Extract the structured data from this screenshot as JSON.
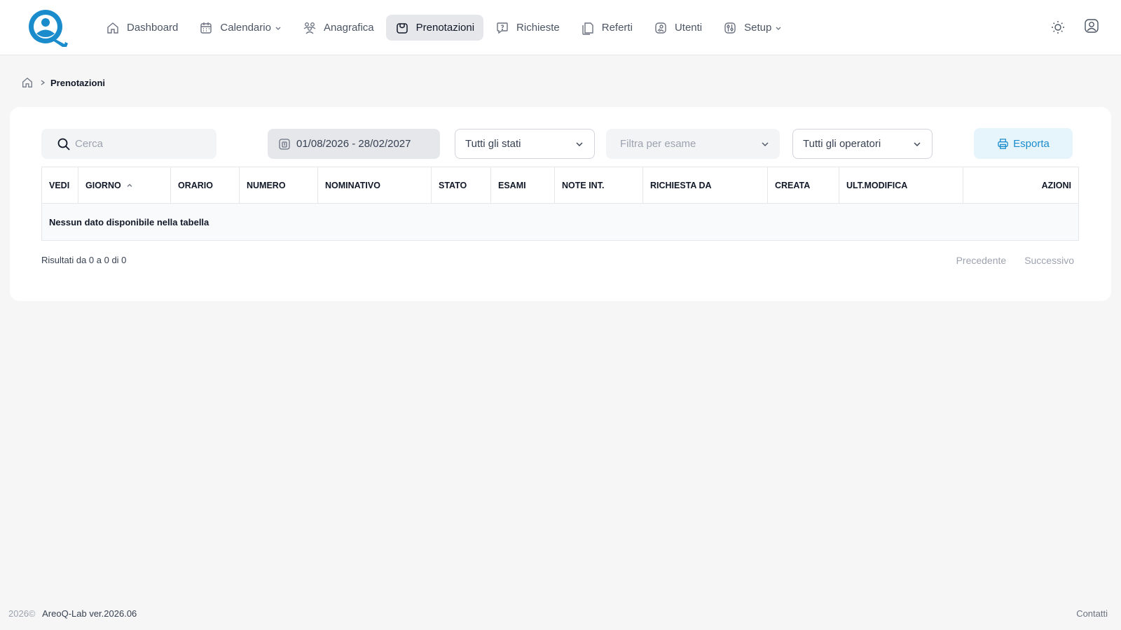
{
  "brand": {
    "logo_icon": "q-logo-icon",
    "accent": "#1a8ccc"
  },
  "nav": {
    "items": [
      {
        "label": "Dashboard",
        "icon": "home-icon",
        "has_dropdown": false,
        "active": false
      },
      {
        "label": "Calendario",
        "icon": "calendar-icon",
        "has_dropdown": true,
        "active": false
      },
      {
        "label": "Anagrafica",
        "icon": "people-icon",
        "has_dropdown": false,
        "active": false
      },
      {
        "label": "Prenotazioni",
        "icon": "booking-icon",
        "has_dropdown": false,
        "active": true
      },
      {
        "label": "Richieste",
        "icon": "question-icon",
        "has_dropdown": false,
        "active": false
      },
      {
        "label": "Referti",
        "icon": "documents-icon",
        "has_dropdown": false,
        "active": false
      },
      {
        "label": "Utenti",
        "icon": "user-badge-icon",
        "has_dropdown": false,
        "active": false
      },
      {
        "label": "Setup",
        "icon": "settings-icon",
        "has_dropdown": true,
        "active": false
      }
    ],
    "theme_icon": "sun-icon",
    "user_icon": "user-icon"
  },
  "breadcrumb": {
    "home_icon": "home-icon",
    "current": "Prenotazioni"
  },
  "filters": {
    "search_placeholder": "Cerca",
    "date_range": "01/08/2026 - 28/02/2027",
    "stato": "Tutti gli stati",
    "esame_placeholder": "Filtra per esame",
    "operatore": "Tutti gli operatori",
    "export_label": "Esporta"
  },
  "table": {
    "columns": [
      "VEDI",
      "GIORNO",
      "ORARIO",
      "NUMERO",
      "NOMINATIVO",
      "STATO",
      "ESAMI",
      "NOTE INT.",
      "RICHIESTA DA",
      "CREATA",
      "ULT.MODIFICA",
      "AZIONI"
    ],
    "sorted_column": "GIORNO",
    "sort_direction": "asc",
    "empty_message": "Nessun dato disponibile nella tabella"
  },
  "pagination": {
    "info": "Risultati da 0 a 0 di 0",
    "prev_label": "Precedente",
    "next_label": "Successivo"
  },
  "footer": {
    "year": "2026©",
    "app": "AreoQ-Lab ver.2026.06",
    "contact": "Contatti"
  }
}
